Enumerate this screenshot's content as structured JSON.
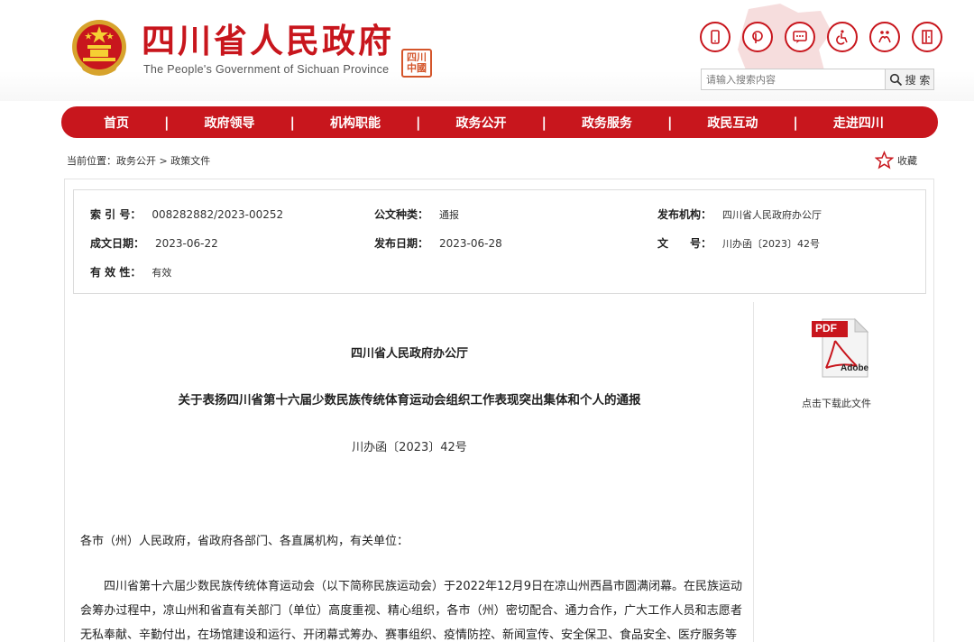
{
  "header": {
    "title": "四川省人民政府",
    "subtitle": "The People's Government of Sichuan Province",
    "seal_text": "四川中國",
    "tool_icons": [
      "mobile-icon",
      "weibo-icon",
      "message-icon",
      "accessibility-icon",
      "elderly-care-icon",
      "exit-icon"
    ],
    "brand_color": "#c8161d"
  },
  "search": {
    "placeholder": "请输入搜索内容",
    "button_label": "搜 索"
  },
  "nav": {
    "items": [
      "首页",
      "政府领导",
      "机构职能",
      "政务公开",
      "政务服务",
      "政民互动",
      "走进四川"
    ],
    "separator": "|"
  },
  "breadcrumb": {
    "prefix": "当前位置：",
    "level1": "政务公开",
    "arrow": " > ",
    "level2": "政策文件"
  },
  "favorite": {
    "label": "收藏"
  },
  "meta": {
    "index_label": "索 引 号：",
    "index_value": "008282882/2023-00252",
    "category_label": "公文种类：",
    "category_value": "通报",
    "publisher_label": "发布机构：",
    "publisher_value": "四川省人民政府办公厅",
    "written_label": "成文日期：",
    "written_value": "2023-06-22",
    "published_label": "发布日期：",
    "published_value": "2023-06-28",
    "docno_label": "文　　号：",
    "docno_value": "川办函〔2023〕42号",
    "validity_label": "有 效 性：",
    "validity_value": "有效"
  },
  "document": {
    "org": "四川省人民政府办公厅",
    "title": "关于表扬四川省第十六届少数民族传统体育运动会组织工作表现突出集体和个人的通报",
    "number": "川办函〔2023〕42号",
    "salutation": "各市（州）人民政府，省政府各部门、各直属机构，有关单位：",
    "paragraph1": "四川省第十六届少数民族传统体育运动会（以下简称民族运动会）于2022年12月9日在凉山州西昌市圆满闭幕。在民族运动会筹办过程中，凉山州和省直有关部门（单位）高度重视、精心组织，各市（州）密切配合、通力合作，广大工作人员和志愿者无私奉献、辛勤付出，在场馆建设和运行、开闭幕式筹办、赛事组织、疫情防控、新闻宣传、安全保卫、食品安全、医疗服务等"
  },
  "download": {
    "pdf_label": "PDF",
    "adobe_label": "Adobe",
    "caption": "点击下载此文件"
  }
}
